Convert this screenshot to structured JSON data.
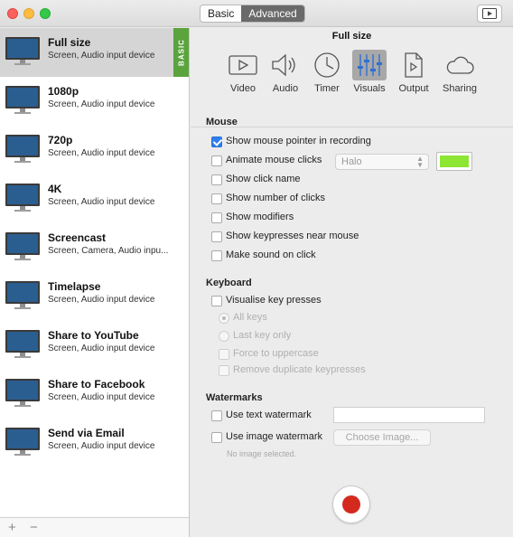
{
  "titlebar": {
    "mode_tabs": [
      "Basic",
      "Advanced"
    ],
    "active_mode": "Advanced",
    "right_icon": "play-screen-icon"
  },
  "sidebar": {
    "badge": "BASIC",
    "presets": [
      {
        "name": "Full size",
        "sub": "Screen, Audio input device",
        "selected": true
      },
      {
        "name": "1080p",
        "sub": "Screen, Audio input device"
      },
      {
        "name": "720p",
        "sub": "Screen, Audio input device"
      },
      {
        "name": "4K",
        "sub": "Screen, Audio input device"
      },
      {
        "name": "Screencast",
        "sub": "Screen, Camera, Audio inpu..."
      },
      {
        "name": "Timelapse",
        "sub": "Screen, Audio input device"
      },
      {
        "name": "Share to YouTube",
        "sub": "Screen, Audio input device"
      },
      {
        "name": "Share to Facebook",
        "sub": "Screen, Audio input device"
      },
      {
        "name": "Send via Email",
        "sub": "Screen, Audio input device"
      }
    ],
    "footer": {
      "add": "+",
      "remove": "−"
    }
  },
  "main": {
    "title": "Full size",
    "tabs": [
      {
        "label": "Video",
        "icon": "video-icon"
      },
      {
        "label": "Audio",
        "icon": "speaker-icon"
      },
      {
        "label": "Timer",
        "icon": "clock-icon"
      },
      {
        "label": "Visuals",
        "icon": "sliders-icon",
        "active": true
      },
      {
        "label": "Output",
        "icon": "document-icon"
      },
      {
        "label": "Sharing",
        "icon": "cloud-icon"
      }
    ],
    "mouse": {
      "title": "Mouse",
      "options": [
        {
          "label": "Show mouse pointer in recording",
          "checked": true
        },
        {
          "label": "Animate mouse clicks",
          "checked": false
        },
        {
          "label": "Show click name",
          "checked": false
        },
        {
          "label": "Show number of clicks",
          "checked": false
        },
        {
          "label": "Show modifiers",
          "checked": false
        },
        {
          "label": "Show keypresses near mouse",
          "checked": false
        },
        {
          "label": "Make sound on click",
          "checked": false
        }
      ],
      "animation_style": "Halo",
      "click_color": "#8de534"
    },
    "keyboard": {
      "title": "Keyboard",
      "visualise": "Visualise key presses",
      "radio_all": "All keys",
      "radio_last": "Last key only",
      "force_upper": "Force to uppercase",
      "remove_dup": "Remove duplicate keypresses"
    },
    "watermarks": {
      "title": "Watermarks",
      "text_label": "Use text watermark",
      "text_value": "",
      "image_label": "Use image watermark",
      "choose_image": "Choose Image...",
      "no_image": "No image selected."
    }
  },
  "colors": {
    "record": "#d42a1e",
    "badge": "#5aa33d",
    "checkbox_checked": "#2f7ded"
  }
}
